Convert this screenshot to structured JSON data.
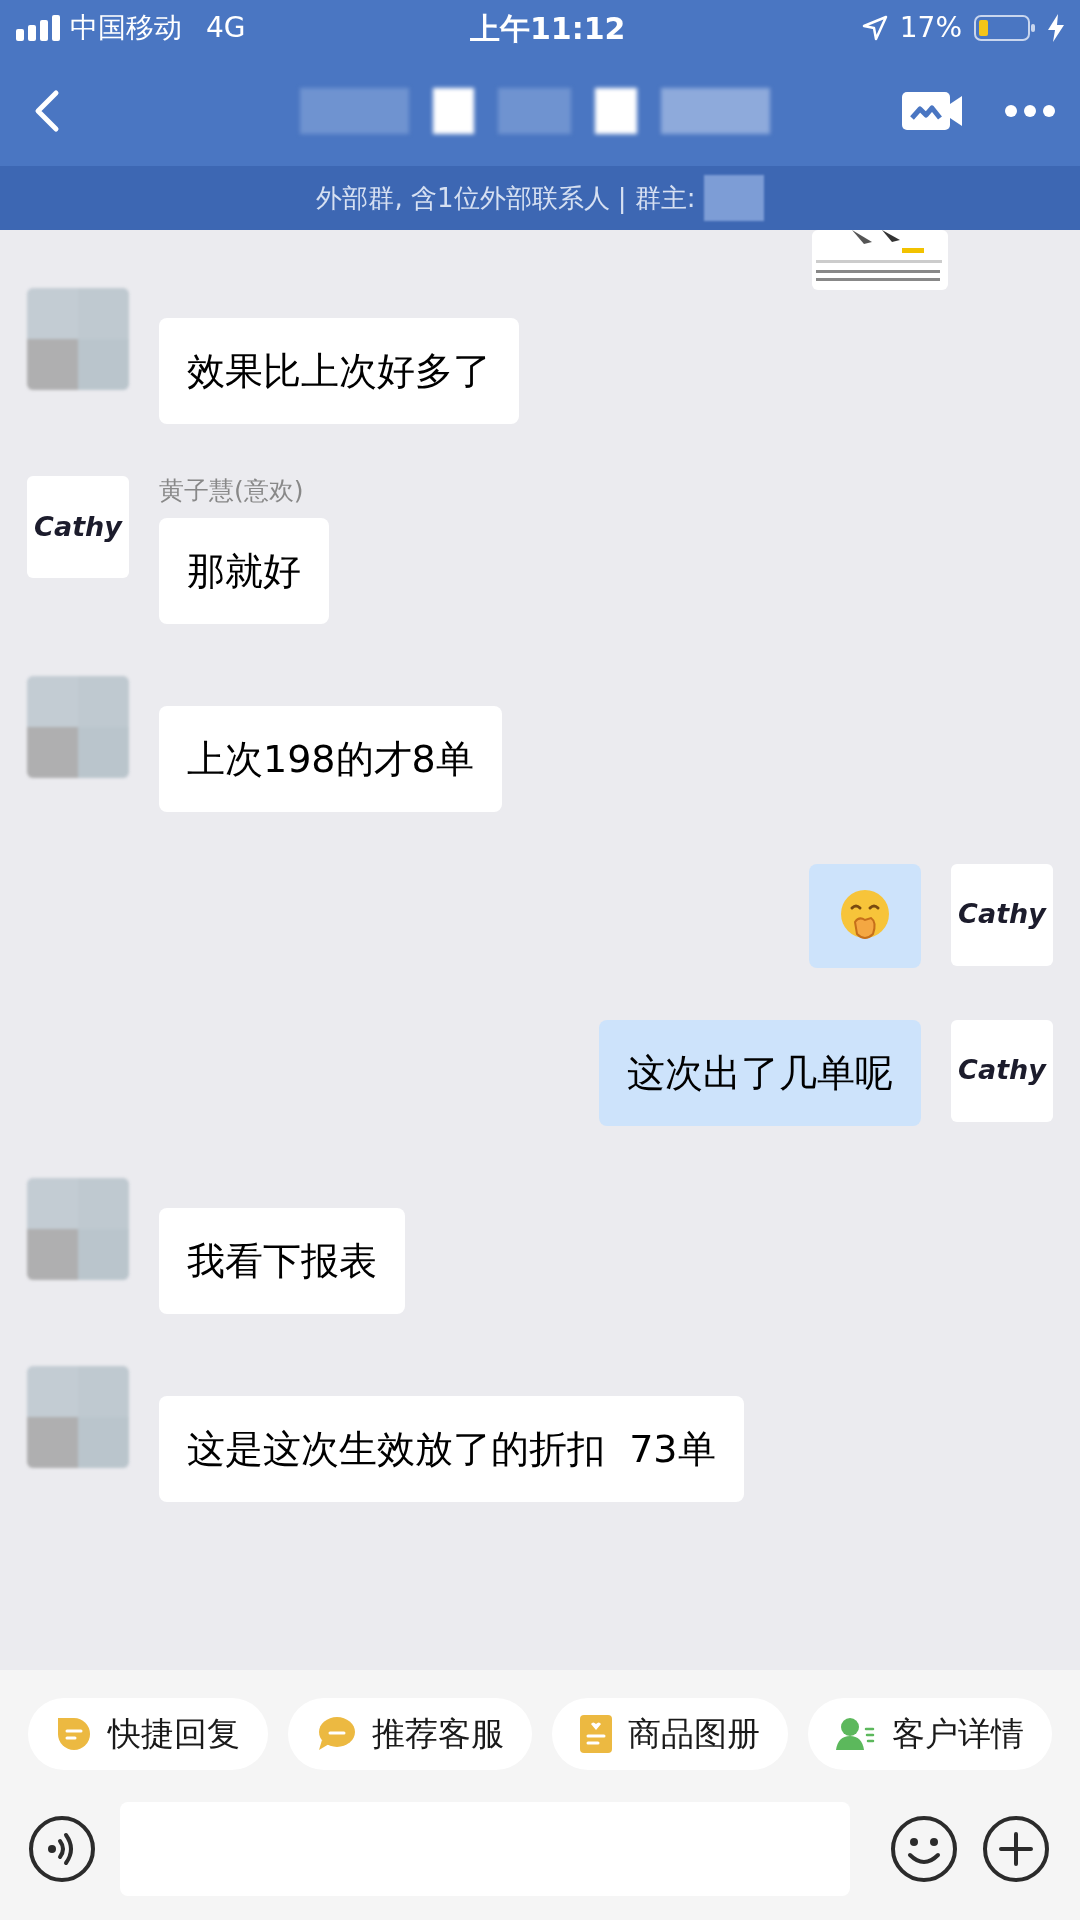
{
  "status_bar": {
    "carrier": "中国移动",
    "network": "4G",
    "time": "上午11:12",
    "battery": "17%"
  },
  "header": {
    "subtitle": "外部群, 含1位外部联系人 | 群主:"
  },
  "messages": [
    {
      "kind": "card"
    },
    {
      "kind": "received",
      "text": "效果比上次好多了"
    },
    {
      "kind": "received-logo",
      "avatar_text": "Cathy",
      "sender": "黄子慧(意欢)",
      "text": "那就好"
    },
    {
      "kind": "received",
      "text": "上次198的才8单"
    },
    {
      "kind": "sent-sticker",
      "avatar_text": "Cathy"
    },
    {
      "kind": "sent",
      "avatar_text": "Cathy",
      "text": "这次出了几单呢"
    },
    {
      "kind": "received",
      "text": "我看下报表"
    },
    {
      "kind": "received",
      "text": "这是这次生效放了的折扣  73单"
    }
  ],
  "quick_actions": [
    {
      "label": "快捷回复"
    },
    {
      "label": "推荐客服"
    },
    {
      "label": "商品图册"
    },
    {
      "label": "客户详情"
    }
  ]
}
